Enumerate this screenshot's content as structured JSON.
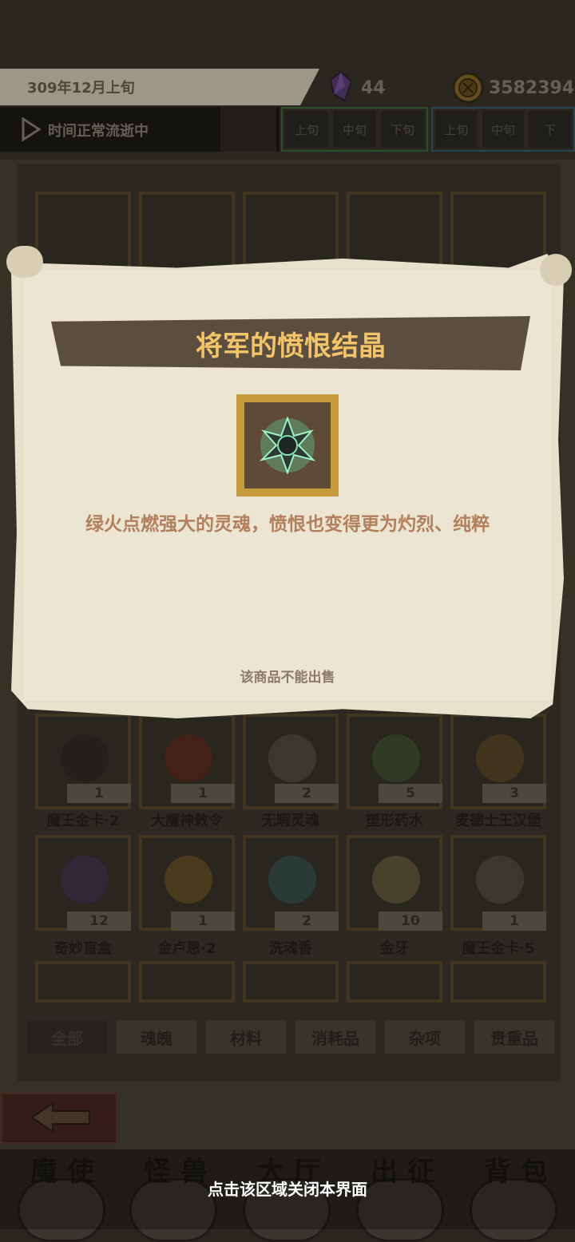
{
  "header": {
    "date": "309年12月上旬",
    "crystal_count": "44",
    "gold_count": "3582394",
    "time_status": "时间正常流逝中",
    "period_group1": [
      "上旬",
      "中旬",
      "下旬"
    ],
    "period_group2": [
      "上旬",
      "中旬",
      "下"
    ]
  },
  "inventory": {
    "row1": [
      {
        "name": "魔王金卡·2",
        "count": "1"
      },
      {
        "name": "大魔神敕令",
        "count": "1"
      },
      {
        "name": "无暇灵魂",
        "count": "2"
      },
      {
        "name": "塑形药水",
        "count": "5"
      },
      {
        "name": "麦德士王汉堡",
        "count": "3"
      }
    ],
    "row2": [
      {
        "name": "奇妙盲盒",
        "count": "12"
      },
      {
        "name": "金卢恩·2",
        "count": "1"
      },
      {
        "name": "洗魂香",
        "count": "2"
      },
      {
        "name": "金牙",
        "count": "10"
      },
      {
        "name": "魔王金卡·5",
        "count": "1"
      }
    ]
  },
  "tabs": [
    "全部",
    "魂魄",
    "材料",
    "消耗品",
    "杂项",
    "贵重品"
  ],
  "nav": [
    "魔使",
    "怪兽",
    "大厅",
    "出征",
    "背包"
  ],
  "modal": {
    "title": "将军的愤恨结晶",
    "description": "绿火点燃强大的灵魂，愤恨也变得更为灼烈、纯粹",
    "sell_status": "该商品不能出售"
  },
  "close_hint": "点击该区域关闭本界面",
  "colors": {
    "title_gold": "#f3c46a",
    "desc_brown": "#b2805c",
    "parchment": "#ece5d2",
    "banner": "#5b4e3f"
  }
}
